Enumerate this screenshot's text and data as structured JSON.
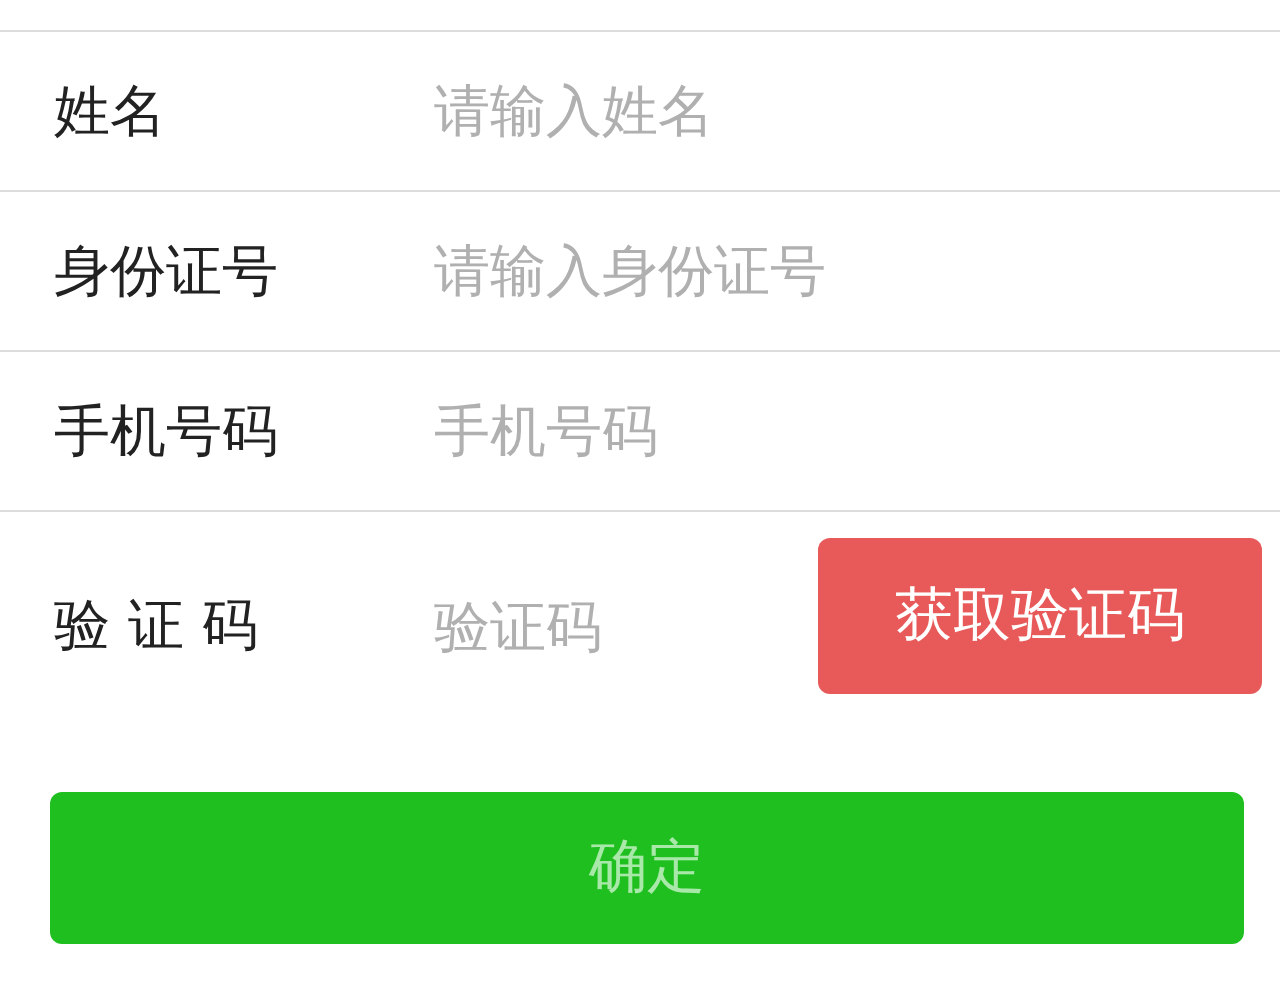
{
  "fields": [
    {
      "label": "姓名",
      "placeholder": "请输入姓名"
    },
    {
      "label": "身份证号",
      "placeholder": "请输入身份证号"
    },
    {
      "label": "手机号码",
      "placeholder": "手机号码"
    },
    {
      "label": "验 证 码",
      "placeholder": "验证码",
      "action": {
        "label": "获取验证码"
      }
    }
  ],
  "submit": {
    "label": "确定",
    "disabled": true
  }
}
